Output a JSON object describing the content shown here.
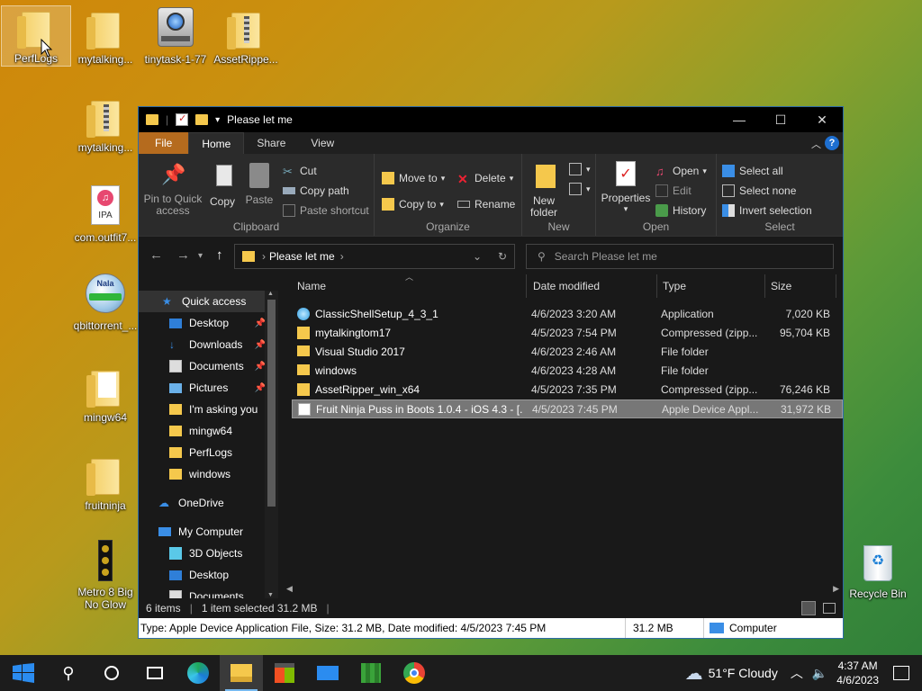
{
  "desktop": {
    "icons": [
      {
        "label": "PerfLogs"
      },
      {
        "label": "mytalking..."
      },
      {
        "label": "tinytask-1-77"
      },
      {
        "label": "AssetRippe..."
      },
      {
        "label": "mytalking..."
      },
      {
        "label": "com.outfit7..."
      },
      {
        "label": "qbittorrent_..."
      },
      {
        "label": "mingw64"
      },
      {
        "label": "fruitninja"
      },
      {
        "label": "Metro 8 Big No Glow"
      },
      {
        "label": "Recycle Bin"
      }
    ],
    "ipa_badge": "IPA",
    "nala_badge": "Nala"
  },
  "window": {
    "title": "‏Please let me",
    "tabs": [
      "File",
      "Home",
      "Share",
      "View"
    ],
    "ribbon": {
      "clipboard": {
        "label": "Clipboard",
        "pin": "Pin to Quick access",
        "copy": "Copy",
        "paste": "Paste",
        "cut": "Cut",
        "copy_path": "Copy path",
        "paste_shortcut": "Paste shortcut"
      },
      "organize": {
        "label": "Organize",
        "move_to": "Move to",
        "copy_to": "Copy to",
        "delete": "Delete",
        "rename": "Rename"
      },
      "new": {
        "label": "New",
        "new_folder": "New folder"
      },
      "open": {
        "label": "Open",
        "properties": "Properties",
        "open": "Open",
        "edit": "Edit",
        "history": "History"
      },
      "select": {
        "label": "Select",
        "select_all": "Select all",
        "select_none": "Select none",
        "invert": "Invert selection"
      }
    },
    "address": {
      "path": "‏Please let me"
    },
    "search": {
      "placeholder": "Search ‏Please let me"
    },
    "nav": {
      "quick_access": "Quick access",
      "items": [
        {
          "label": "Desktop",
          "pinned": true
        },
        {
          "label": "Downloads",
          "pinned": true
        },
        {
          "label": "Documents",
          "pinned": true
        },
        {
          "label": "Pictures",
          "pinned": true
        },
        {
          "label": "I'm  asking you",
          "pinned": false
        },
        {
          "label": "mingw64",
          "pinned": false
        },
        {
          "label": "PerfLogs",
          "pinned": false
        },
        {
          "label": "windows",
          "pinned": false
        }
      ],
      "onedrive": "OneDrive",
      "mycomputer": "My Computer",
      "pc_items": [
        "3D Objects",
        "Desktop",
        "Documents"
      ]
    },
    "columns": [
      "Name",
      "Date modified",
      "Type",
      "Size"
    ],
    "files": [
      {
        "name": "ClassicShellSetup_4_3_1",
        "date": "4/6/2023 3:20 AM",
        "type": "Application",
        "size": "7,020 KB",
        "icon": "app"
      },
      {
        "name": "mytalkingtom17",
        "date": "4/5/2023 7:54 PM",
        "type": "Compressed (zipp...",
        "size": "95,704 KB",
        "icon": "zip"
      },
      {
        "name": "Visual Studio 2017",
        "date": "4/6/2023 2:46 AM",
        "type": "File folder",
        "size": "",
        "icon": "folder"
      },
      {
        "name": "windows",
        "date": "4/6/2023 4:28 AM",
        "type": "File folder",
        "size": "",
        "icon": "folder"
      },
      {
        "name": "AssetRipper_win_x64",
        "date": "4/5/2023 7:35 PM",
        "type": "Compressed (zipp...",
        "size": "76,246 KB",
        "icon": "zip"
      },
      {
        "name": "Fruit Ninja Puss in Boots 1.0.4 - iOS 4.3 - [...",
        "date": "4/5/2023 7:45 PM",
        "type": "Apple Device Appl...",
        "size": "31,972 KB",
        "icon": "file",
        "selected": true
      }
    ],
    "status": {
      "items": "6 items",
      "selected": "1 item selected  31.2 MB",
      "sep": "|"
    },
    "info": {
      "text": "Type: Apple Device Application File, Size: 31.2 MB, Date modified: 4/5/2023 7:45 PM",
      "size": "31.2 MB",
      "location": "Computer"
    }
  },
  "taskbar": {
    "weather": "51°F  Cloudy",
    "time": "4:37 AM",
    "date": "4/6/2023"
  },
  "colors": {
    "accent": "#2d6ca8",
    "file_tab": "#b56b1e",
    "selection": "#777777"
  }
}
